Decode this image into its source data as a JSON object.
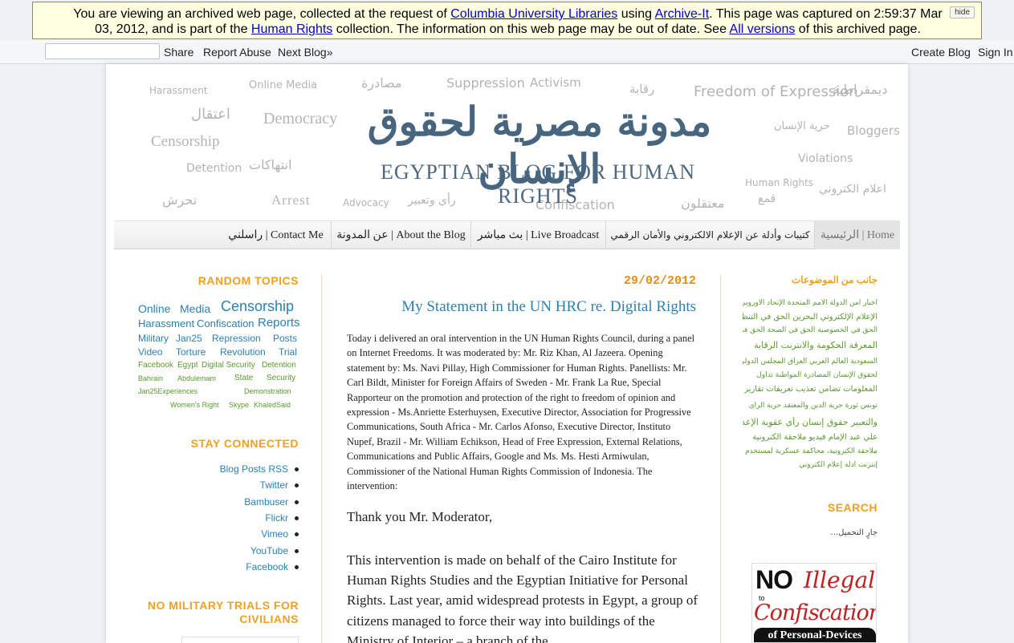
{
  "archive_banner": {
    "text_1": "You are viewing an archived web page, collected at the request of ",
    "link_1": "Columbia University Libraries",
    "text_2": " using ",
    "link_2": "Archive-It",
    "text_3": ". This page was captured on 2:59:37 Mar 03, 2012, and is part of the ",
    "link_3": "Human Rights",
    "text_4": " collection. The information on this web page may be out of date. See ",
    "link_4": "All versions",
    "text_5": " of this archived page.",
    "hide": "hide"
  },
  "navbar": {
    "share": "Share",
    "report_abuse": "Report Abuse",
    "next_blog": "Next Blog»",
    "create_blog": "Create Blog",
    "sign_in": "Sign In"
  },
  "header": {
    "title_ar": "مدونة مصرية لحقوق الإنسان",
    "title_en": "EGYPTIAN BLOG FOR HUMAN RIGHTS",
    "cloud": [
      "Harassment",
      "Online Media",
      "مصادرة",
      "Suppression",
      "Activism",
      "رقابة",
      "Freedom of Expression",
      "ديمقراطية",
      "اعتقال",
      "Democracy",
      "Censorship",
      "انتهاكات",
      "حرية الإنسان",
      "Bloggers",
      "Detention",
      "Violations",
      "Human Rights",
      "اعلام الكتروني",
      "تحرش",
      "Arrest",
      "Advocacy",
      "رأي وتعبير",
      "Confiscation",
      "معتقلون",
      "قمع"
    ]
  },
  "tabs": [
    {
      "label": "الرئيسية | Home"
    },
    {
      "label": "كتيبات وأدلة عن الإعلام الالكتروني والأمان الرقمي"
    },
    {
      "label": "بث مباشر | Live Broadcast"
    },
    {
      "label": "عن المدونة | About the Blog"
    },
    {
      "label": "راسلني | Contact Me"
    }
  ],
  "left_sidebar": {
    "random_topics_heading": "RANDOM TOPICS",
    "tags": [
      "Online",
      "Media",
      "Censorship",
      "Harassment",
      "Confiscation",
      "Reports",
      "Military",
      "Jan25",
      "Repression",
      "Posts",
      "Video",
      "Torture",
      "Revolution",
      "Trial",
      "Facebook",
      "Egypt",
      "Digital Security",
      "Detention",
      "Bahrain",
      "Abdulemam",
      "State",
      "Security",
      "Jan25Experiences",
      "Demonstration",
      "Women's Right",
      "Skype",
      "KhaledSaid"
    ],
    "stay_connected_heading": "STAY CONNECTED",
    "links": [
      "Blog Posts RSS",
      "Twitter",
      "Bambuser",
      "Flickr",
      "Vimeo",
      "YouTube",
      "Facebook"
    ],
    "no_military_heading": "NO MILITARY TRIALS FOR CIVILIANS"
  },
  "post": {
    "date": "29/02/2012",
    "title": "My Statement in the UN HRC re. Digital Rights",
    "intro": "Today i delivered an oral intervention in the UN Human Rights Council, during a panel on Internet Freedoms. It was moderated by: Mr. Riz Khan, Al Jazeera. Opening statement by: Ms. Navi Pillay, High Commissioner for Human Rights. Panellists: Mr. Carl Bildt, Minister for Foreign Affairs of Sweden - Mr. Frank La Rue, Special Rapporteur on the promotion and protection of the right to freedom of opinion and expression - Ms.Anriette Esterhuysen, Executive Director, Association for Progressive Communications, South Africa - Mr. Carlos Afonso, Executive Director, Instituto Nupef, Brazil - Mr. William Echikson, Head of Free Expression, External Relations, Communications and Public Affairs, Google and Ms. Ms. Hesti Armiwulan, Commissioner of the National Human Rights Commission of Indonesia. The intervention:",
    "p1": "Thank you Mr. Moderator,",
    "p2": "This intervention is made on behalf of the Cairo Institute for Human Rights Studies and the Egyptian Initiative for Personal Rights.  Last year, amid widespread protests in Egypt, a group of citizens managed to force their way into buildings of the Ministry of Interior – a branch of the"
  },
  "right_sidebar": {
    "heading": "جانب من الموضوعات",
    "cloud_lines": [
      "أخبار أمن الدولة الأمم المتحدة الإتحاد الأوروبي",
      "الإعلام الإلكتروني البحرين الحق في التنظيم",
      "الحق في الخصوصية الحق في الصحة الحق في",
      "المعرفة الحكومة والانترنت الرقابة",
      "السعودية العالم العربي العراق المجلس الدولي",
      "لحقوق الإنسان المصادرة المواطنة تداول",
      "المعلومات تضامن تعذيب تعريفات تقارير",
      "تونس ثورة حرية الدين والمعتقد حرية الرأي",
      "والتعبير حقوق إنسان رأي عقوبة الإعدام",
      "علي عبد الإمام فيديو ملاحقة الكترونية",
      "ملاحقة الكترونية، محاكمة عسكرية لمستخدم",
      "إنترنت أدلة إعلام الكتروني"
    ],
    "search_heading": "SEARCH",
    "loading": "...جارٍ التحميل",
    "badge": {
      "no": "NO",
      "to": "to",
      "illegal": "Illegal",
      "confiscation": "Confiscation",
      "personal_devices": "of Personal-Devices"
    }
  },
  "colors": {
    "accent_orange": "#f0a020",
    "link_blue": "#2b80b3",
    "tag_green": "#5a9a2c",
    "banner_bg": "#ffffe1"
  }
}
